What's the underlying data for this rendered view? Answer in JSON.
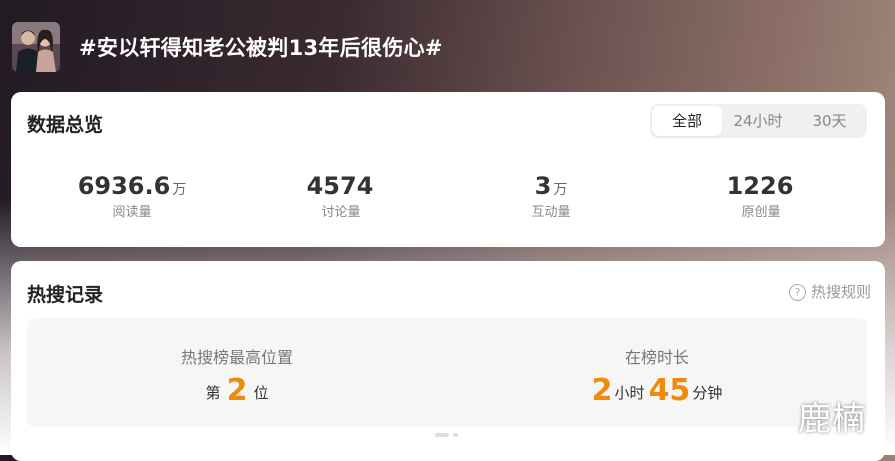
{
  "header": {
    "title": "#安以轩得知老公被判13年后很伤心#"
  },
  "overview": {
    "title": "数据总览",
    "tabs": [
      {
        "label": "全部",
        "active": true
      },
      {
        "label": "24小时",
        "active": false
      },
      {
        "label": "30天",
        "active": false
      }
    ],
    "stats": [
      {
        "value": "6936.6",
        "unit": "万",
        "label": "阅读量"
      },
      {
        "value": "4574",
        "unit": "",
        "label": "讨论量"
      },
      {
        "value": "3",
        "unit": "万",
        "label": "互动量"
      },
      {
        "value": "1226",
        "unit": "",
        "label": "原创量"
      }
    ]
  },
  "hot_search": {
    "title": "热搜记录",
    "rules_link": "热搜规则",
    "peak_position": {
      "label": "热搜榜最高位置",
      "prefix": "第",
      "value": "2",
      "suffix": "位"
    },
    "duration": {
      "label": "在榜时长",
      "hours": "2",
      "hours_unit": "小时",
      "minutes": "45",
      "minutes_unit": "分钟"
    }
  },
  "watermark": "鹿楠",
  "colors": {
    "accent_number": "#f08a0c",
    "card_background": "#ffffff",
    "record_background": "#f6f6f6"
  },
  "icons": {
    "help": "question-circle-icon",
    "avatar": "topic-avatar-photo"
  }
}
